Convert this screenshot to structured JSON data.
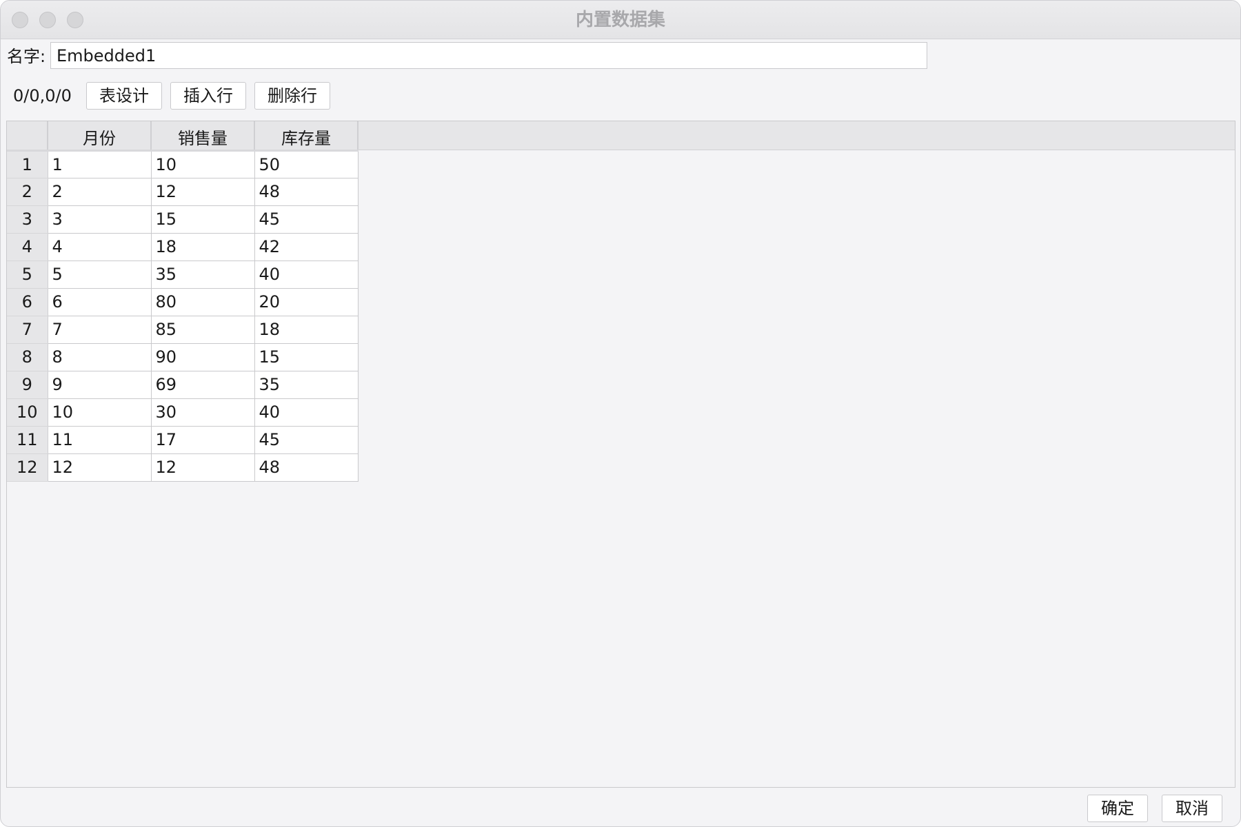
{
  "window": {
    "title": "内置数据集"
  },
  "name_field": {
    "label": "名字:",
    "value": "Embedded1"
  },
  "toolbar": {
    "coords": "0/0,0/0",
    "table_design_label": "表设计",
    "insert_row_label": "插入行",
    "delete_row_label": "删除行"
  },
  "table": {
    "columns": [
      "月份",
      "销售量",
      "库存量"
    ],
    "rows": [
      [
        "1",
        "1",
        "10",
        "50"
      ],
      [
        "2",
        "2",
        "12",
        "48"
      ],
      [
        "3",
        "3",
        "15",
        "45"
      ],
      [
        "4",
        "4",
        "18",
        "42"
      ],
      [
        "5",
        "5",
        "35",
        "40"
      ],
      [
        "6",
        "6",
        "80",
        "20"
      ],
      [
        "7",
        "7",
        "85",
        "18"
      ],
      [
        "8",
        "8",
        "90",
        "15"
      ],
      [
        "9",
        "9",
        "69",
        "35"
      ],
      [
        "10",
        "10",
        "30",
        "40"
      ],
      [
        "11",
        "11",
        "17",
        "45"
      ],
      [
        "12",
        "12",
        "12",
        "48"
      ]
    ]
  },
  "footer": {
    "ok_label": "确定",
    "cancel_label": "取消"
  }
}
